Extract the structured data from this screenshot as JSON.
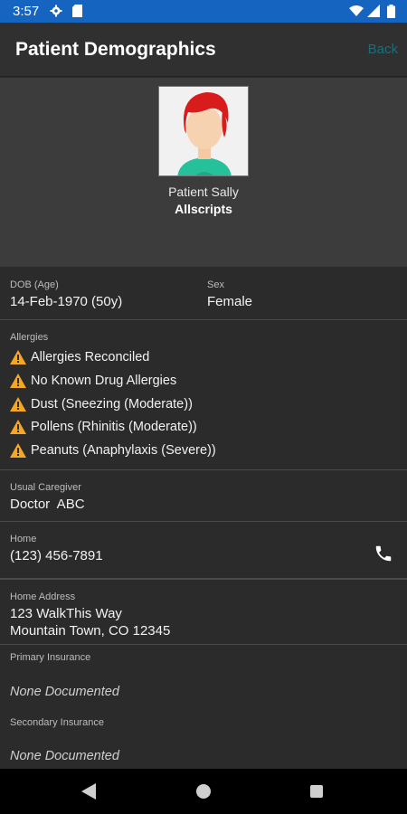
{
  "status_bar": {
    "time": "3:57",
    "icons": [
      "gear-icon",
      "sd-card-icon",
      "wifi-icon",
      "signal-icon",
      "battery-icon"
    ]
  },
  "app_bar": {
    "title": "Patient Demographics",
    "back_label": "Back"
  },
  "profile": {
    "name": "Patient Sally",
    "organization": "Allscripts"
  },
  "demographics": {
    "dob_label": "DOB (Age)",
    "dob_value": "14-Feb-1970 (50y)",
    "sex_label": "Sex",
    "sex_value": "Female"
  },
  "allergies": {
    "label": "Allergies",
    "items": [
      "Allergies Reconciled",
      "No Known Drug Allergies",
      "Dust (Sneezing (Moderate))",
      "Pollens (Rhinitis (Moderate))",
      "Peanuts (Anaphylaxis (Severe))"
    ]
  },
  "caregiver": {
    "label": "Usual Caregiver",
    "value": "Doctor  ABC"
  },
  "phone": {
    "label": "Home",
    "value": "(123) 456-7891"
  },
  "address": {
    "label": "Home Address",
    "line1": "123 WalkThis Way",
    "line2": "Mountain Town, CO 12345"
  },
  "insurance": {
    "primary_label": "Primary Insurance",
    "primary_value": "None Documented",
    "secondary_label": "Secondary Insurance",
    "secondary_value": "None Documented"
  },
  "colors": {
    "status_bar": "#1565c0",
    "background": "#2b2b2b",
    "back_link": "#1a6f7a",
    "warning": "#f5a623"
  }
}
